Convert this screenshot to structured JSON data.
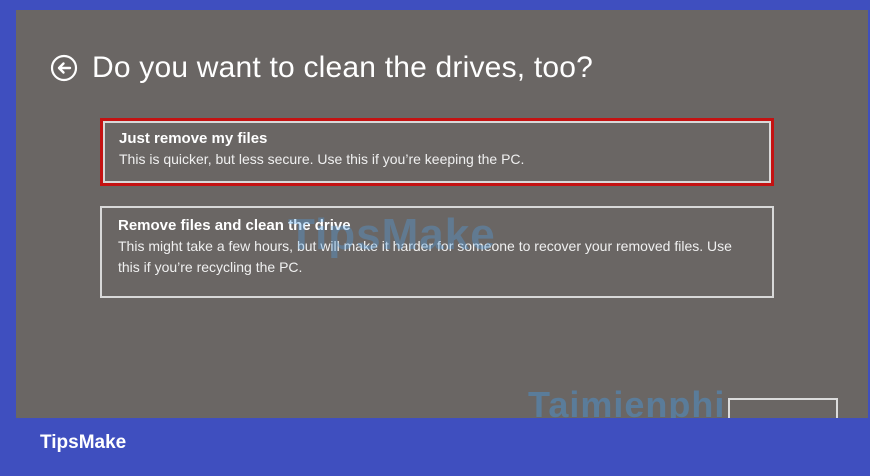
{
  "dialog": {
    "title": "Do you want to clean the drives, too?",
    "back_icon": "back-arrow-circle-icon",
    "options": [
      {
        "title": "Just remove my files",
        "description": "This is quicker, but less secure. Use this if you’re keeping the PC.",
        "selected": true
      },
      {
        "title": "Remove files and clean the drive",
        "description": "This might take a few hours, but will make it harder for someone to recover your removed files. Use this if you’re recycling the PC.",
        "selected": false
      }
    ]
  },
  "watermarks": {
    "middle": "TipsMake",
    "bottom": "Taimienphi"
  },
  "footer": {
    "brand": "TipsMake"
  },
  "colors": {
    "frame": "#3f4fbf",
    "screen_background": "#6a6664",
    "selection_border": "#c41212",
    "option_border": "#d8d8d8",
    "text": "#ffffff"
  }
}
